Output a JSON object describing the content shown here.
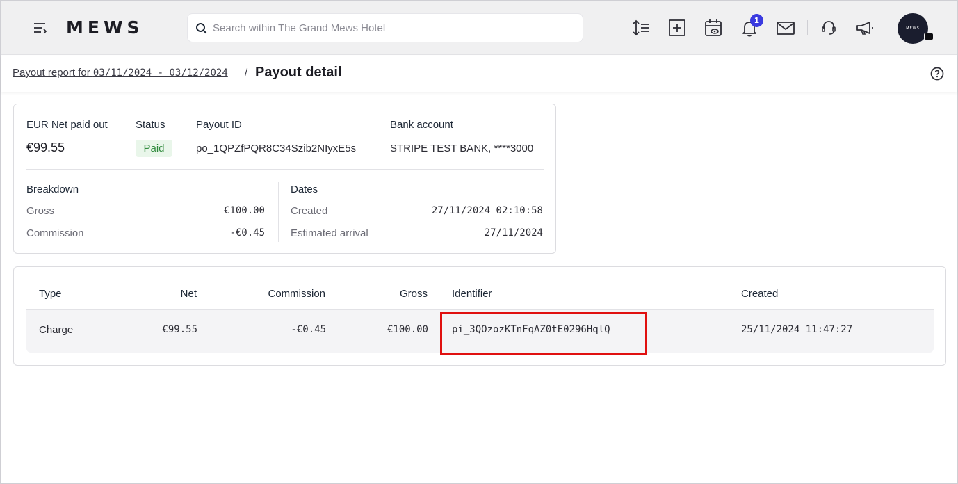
{
  "header": {
    "logo": "MEWS",
    "search_placeholder": "Search within The Grand Mews Hotel",
    "notification_count": "1",
    "avatar_text": "MEWS",
    "icons": [
      "menu-icon",
      "sort-icon",
      "add-icon",
      "calendar-view-icon",
      "bell-icon",
      "mail-icon",
      "support-icon",
      "megaphone-icon"
    ]
  },
  "breadcrumb": {
    "link_prefix": "Payout report for ",
    "link_dates": "03/11/2024 - 03/12/2024",
    "separator": "/",
    "current": "Payout detail"
  },
  "summary": {
    "net_label": "EUR Net paid out",
    "net_value": "€99.55",
    "status_label": "Status",
    "status_value": "Paid",
    "payout_id_label": "Payout ID",
    "payout_id_value": "po_1QPZfPQR8C34Szib2NIyxE5s",
    "bank_label": "Bank account",
    "bank_value": "STRIPE TEST BANK, ****3000",
    "breakdown": {
      "title": "Breakdown",
      "gross_label": "Gross",
      "gross_value": "€100.00",
      "commission_label": "Commission",
      "commission_value": "-€0.45"
    },
    "dates": {
      "title": "Dates",
      "created_label": "Created",
      "created_value": "27/11/2024 02:10:58",
      "arrival_label": "Estimated arrival",
      "arrival_value": "27/11/2024"
    }
  },
  "table": {
    "columns": [
      "Type",
      "Net",
      "Commission",
      "Gross",
      "Identifier",
      "Created"
    ],
    "rows": [
      {
        "type": "Charge",
        "net": "€99.55",
        "commission": "-€0.45",
        "gross": "€100.00",
        "identifier": "pi_3QOzozKTnFqAZ0tE0296HqlQ",
        "created": "25/11/2024 11:47:27"
      }
    ]
  },
  "colors": {
    "topbar": "#f0f0f1",
    "accent_badge": "#3a3ae0",
    "paid_bg": "#e9f6ea",
    "paid_text": "#2f8a3c",
    "highlight": "#e01010"
  }
}
